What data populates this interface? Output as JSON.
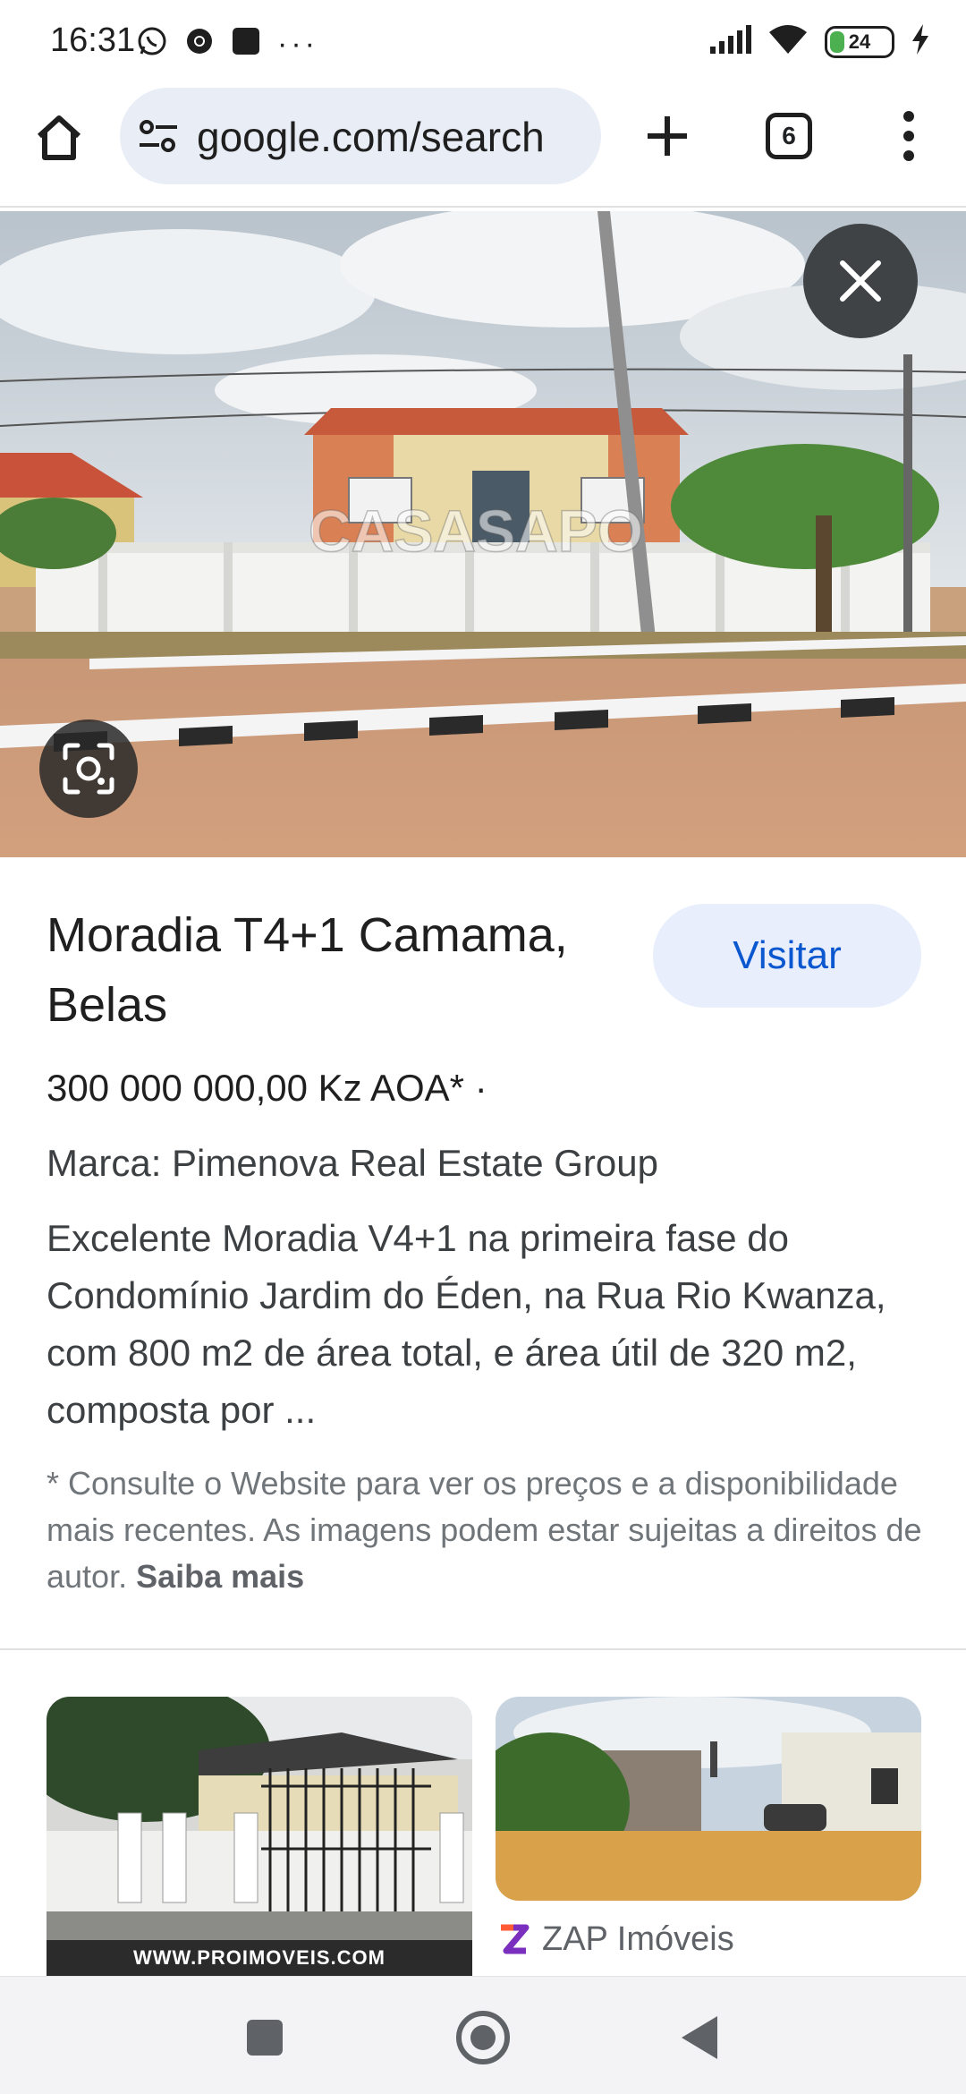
{
  "status_bar": {
    "time": "16:31",
    "battery_level": "24",
    "icons_left": [
      "whatsapp-icon",
      "chrome-icon",
      "app-square-icon",
      "more-dots-icon"
    ],
    "icons_right": [
      "signal-icon",
      "wifi-icon",
      "battery-icon",
      "charging-icon"
    ],
    "more_dots": "···"
  },
  "toolbar": {
    "url": "google.com/search",
    "tab_count": "6",
    "icons": [
      "home-icon",
      "tune-icon",
      "plus-icon",
      "tabs-icon",
      "menu-icon"
    ]
  },
  "hero": {
    "watermark": "CASASAPO"
  },
  "result": {
    "title": "Moradia T4+1 Camama, Belas",
    "visit_label": "Visitar",
    "price": "300 000 000,00 Kz AOA* ·",
    "brand": "Marca: Pimenova Real Estate Group",
    "description": "Excelente Moradia V4+1 na primeira fase do Condomínio Jardim do Éden, na Rua Rio Kwanza, com 800 m2 de área total, e área útil de 320 m2, composta por ...",
    "disclaimer": "* Consulte o Website para ver os preços e a disponibilidade mais recentes. As imagens podem estar sujeitas a direitos de autor.",
    "learn_more": "Saiba mais"
  },
  "related": {
    "thumb1_caption": "WWW.PROIMOVEIS.COM",
    "source2_name": "ZAP Imóveis"
  },
  "colors": {
    "accent_blue": "#0b57d0",
    "visit_bg": "#e8eefb",
    "omnibox_bg": "#e9eef6"
  }
}
